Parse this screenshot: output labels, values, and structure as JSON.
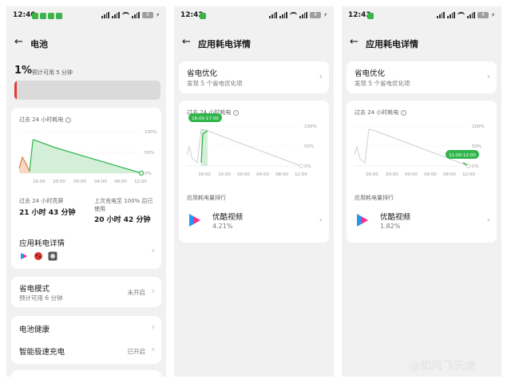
{
  "screens": [
    {
      "status": {
        "time": "12:40",
        "battery": "5"
      },
      "header": {
        "title": "电池"
      },
      "battery": {
        "percent": "1%",
        "estimate": "预计可用 5 分钟",
        "level": 0.01
      },
      "usage_card": {
        "title": "过去 24 小时耗电",
        "y_ticks": [
          "100%",
          "50%",
          "0%"
        ],
        "x_ticks": [
          "16:00",
          "20:00",
          "00:00",
          "04:00",
          "08:00",
          "12:00"
        ],
        "screen_on_label": "过去 24 小时亮屏",
        "screen_on_value": "21 小时 43 分钟",
        "since_charge_label_1": "上次充电至 100% 后已",
        "since_charge_label_2": "使用",
        "since_charge_value": "20 小时 42 分钟",
        "detail_label": "应用耗电详情"
      },
      "power_saving": {
        "title": "省电模式",
        "sub": "预计可用 6 分钟",
        "state": "未开启"
      },
      "battery_health": {
        "title": "电池健康"
      },
      "smart_charge": {
        "title": "智能极速充电",
        "state": "已开启"
      }
    },
    {
      "status": {
        "time": "12:42",
        "battery": "4"
      },
      "header": {
        "title": "应用耗电详情"
      },
      "optimize": {
        "title": "省电优化",
        "sub": "发现 5 个省电优化项"
      },
      "chart": {
        "title": "过去 24 小时耗电",
        "tooltip": "16:00-17:00",
        "y_ticks": [
          "100%",
          "50%",
          "0%"
        ],
        "x_ticks": [
          "16:00",
          "20:00",
          "00:00",
          "04:00",
          "08:00",
          "12:00"
        ]
      },
      "rank_label": "应用耗电量排行",
      "app": {
        "name": "优酷视频",
        "percent": "4.21%"
      }
    },
    {
      "status": {
        "time": "12:42",
        "battery": "4"
      },
      "header": {
        "title": "应用耗电详情"
      },
      "optimize": {
        "title": "省电优化",
        "sub": "发现 5 个省电优化项"
      },
      "chart": {
        "title": "过去 24 小时耗电",
        "tooltip": "11:00-12:00",
        "y_ticks": [
          "100%",
          "50%",
          "0%"
        ],
        "x_ticks": [
          "16:00",
          "20:00",
          "00:00",
          "04:00",
          "08:00",
          "12:00"
        ]
      },
      "rank_label": "应用耗电量排行",
      "app": {
        "name": "优酷视频",
        "percent": "1.82%"
      }
    }
  ],
  "watermark": "@如风飞天虎",
  "colors": {
    "green": "#2fb54a",
    "red": "#e53935",
    "card": "#ffffff",
    "bg": "#f1f1f1"
  }
}
